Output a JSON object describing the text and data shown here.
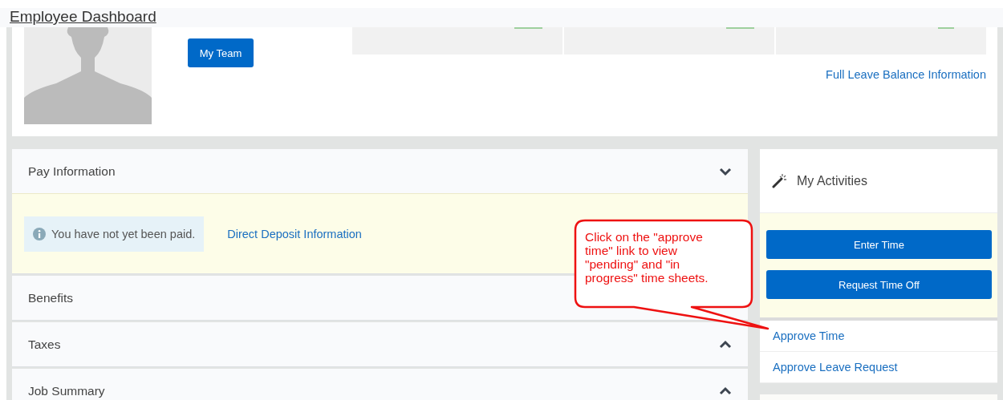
{
  "page_title": "Employee Dashboard",
  "profile": {
    "button": "My Team",
    "leave_balance_link": "Full Leave Balance Information"
  },
  "sections": [
    {
      "title": "Pay Information",
      "expanded": true,
      "message": "You have not yet been paid.",
      "link": "Direct Deposit Information"
    },
    {
      "title": "Benefits"
    },
    {
      "title": "Taxes",
      "expanded": false
    },
    {
      "title": "Job Summary",
      "expanded": false
    }
  ],
  "activities": {
    "title": "My Activities",
    "buttons": [
      "Enter Time",
      "Request Time Off"
    ],
    "links": [
      "Approve Time",
      "Approve Leave Request"
    ]
  },
  "callout": {
    "text": "Click on the \"approve time\" link to view \"pending\" and \"in progress\" time sheets."
  }
}
